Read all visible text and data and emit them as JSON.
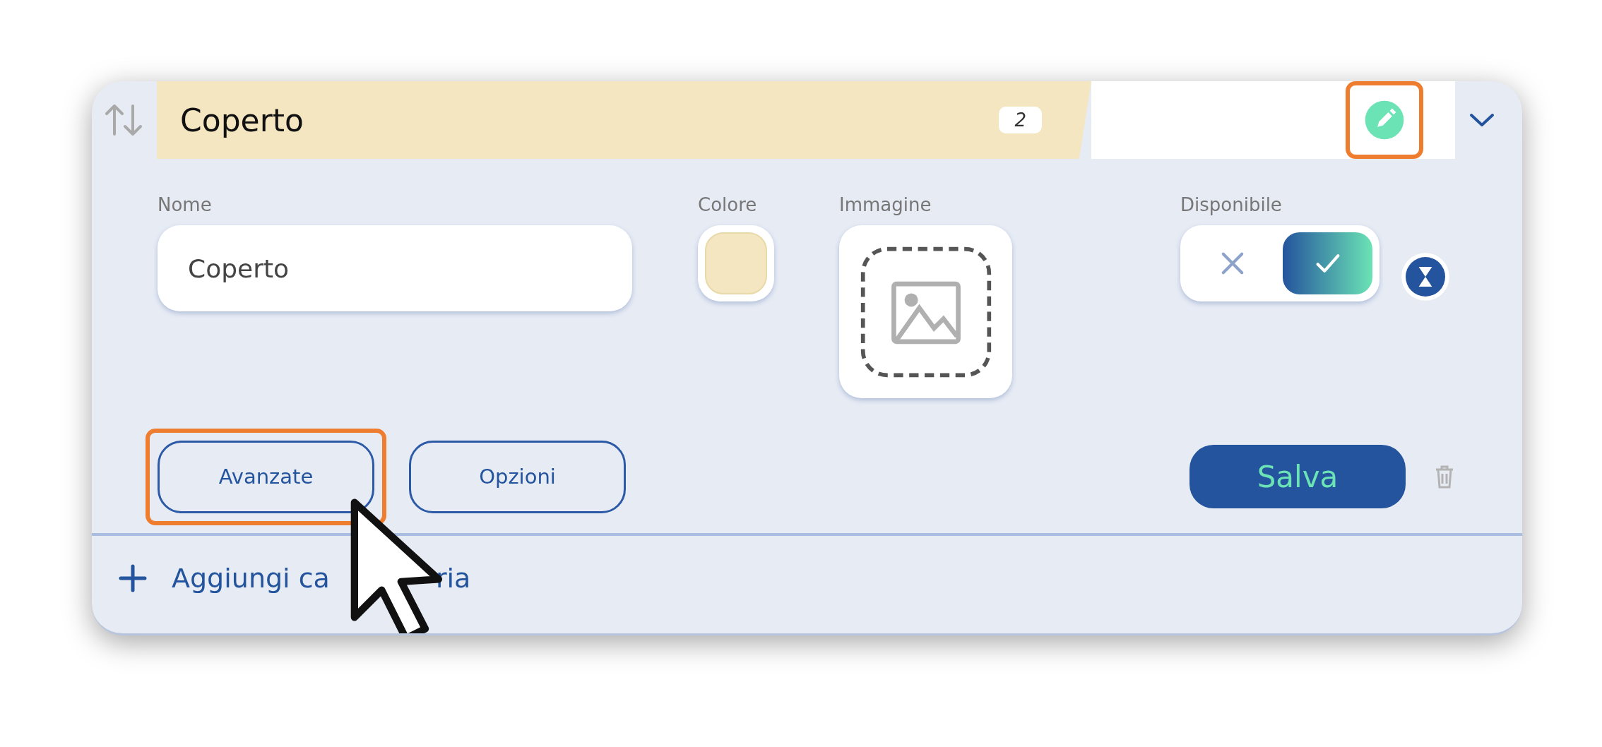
{
  "category": {
    "title": "Coperto",
    "count": "2",
    "expanded": true,
    "edit_highlighted": true
  },
  "fields": [
    {
      "kind": "text",
      "label": "Nome",
      "value": "Coperto"
    },
    {
      "kind": "color",
      "label": "Colore",
      "color": "#f3e6c0"
    },
    {
      "kind": "image",
      "label": "Immagine"
    },
    {
      "kind": "toggle",
      "label": "Disponibile",
      "on": true
    }
  ],
  "buttons": [
    {
      "label": "Avanzate",
      "kind": "outline",
      "highlighted": true
    },
    {
      "label": "Opzioni",
      "kind": "outline",
      "highlighted": false
    },
    {
      "label": "Salva",
      "kind": "primary",
      "highlighted": false
    }
  ],
  "add_category": {
    "parts": [
      "Aggiungi ca",
      "ria"
    ]
  }
}
